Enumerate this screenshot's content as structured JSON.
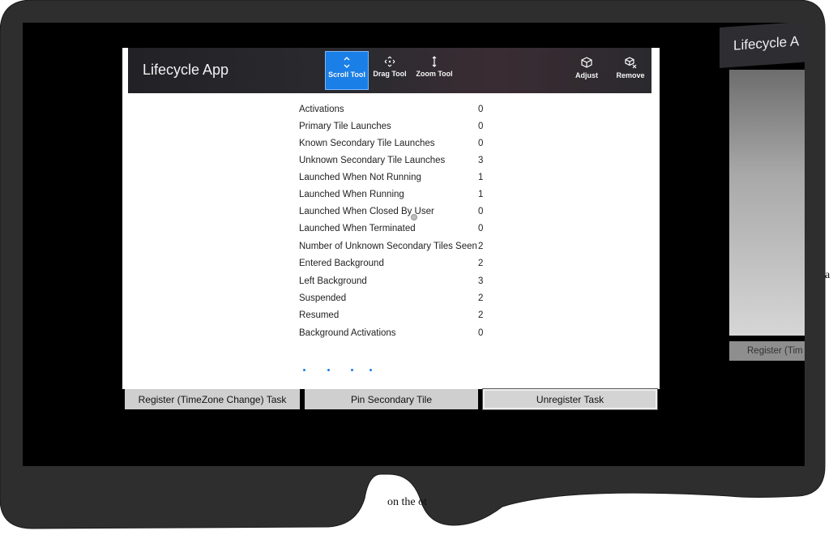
{
  "app": {
    "title": "Lifecycle App",
    "tools": [
      {
        "label": "Scroll Tool",
        "icon": "scroll-icon",
        "active": true
      },
      {
        "label": "Drag Tool",
        "icon": "drag-icon",
        "active": false
      },
      {
        "label": "Zoom Tool",
        "icon": "zoom-icon",
        "active": false
      }
    ],
    "actions": [
      {
        "label": "Adjust",
        "icon": "adjust-cube-icon"
      },
      {
        "label": "Remove",
        "icon": "remove-cube-icon"
      }
    ],
    "stats": [
      {
        "label": "Activations",
        "value": "0"
      },
      {
        "label": "Primary Tile Launches",
        "value": "0"
      },
      {
        "label": "Known Secondary Tile Launches",
        "value": "0"
      },
      {
        "label": "Unknown Secondary Tile Launches",
        "value": "3"
      },
      {
        "label": "Launched When Not Running",
        "value": "1"
      },
      {
        "label": "Launched When Running",
        "value": "1"
      },
      {
        "label": "Launched When Closed By User",
        "value": "0"
      },
      {
        "label": "Launched When Terminated",
        "value": "0"
      },
      {
        "label": "Number of Unknown Secondary Tiles Seen",
        "value": "2"
      },
      {
        "label": "Entered Background",
        "value": "2"
      },
      {
        "label": "Left Background",
        "value": "3"
      },
      {
        "label": "Suspended",
        "value": "2"
      },
      {
        "label": "Resumed",
        "value": "2"
      },
      {
        "label": "Background Activations",
        "value": "0"
      }
    ],
    "buttons": {
      "register": "Register (TimeZone Change) Task",
      "pin": "Pin Secondary Tile",
      "unregister": "Unregister Task"
    }
  },
  "secondary_app": {
    "title": "Lifecycle A",
    "button": "Register (Tim"
  },
  "document": {
    "bottom_text": "on the ot",
    "right_text": "a"
  },
  "colors": {
    "accent": "#1a7fe6",
    "titlebar": "#2a2a2e",
    "frame": "#2d2d2d"
  }
}
